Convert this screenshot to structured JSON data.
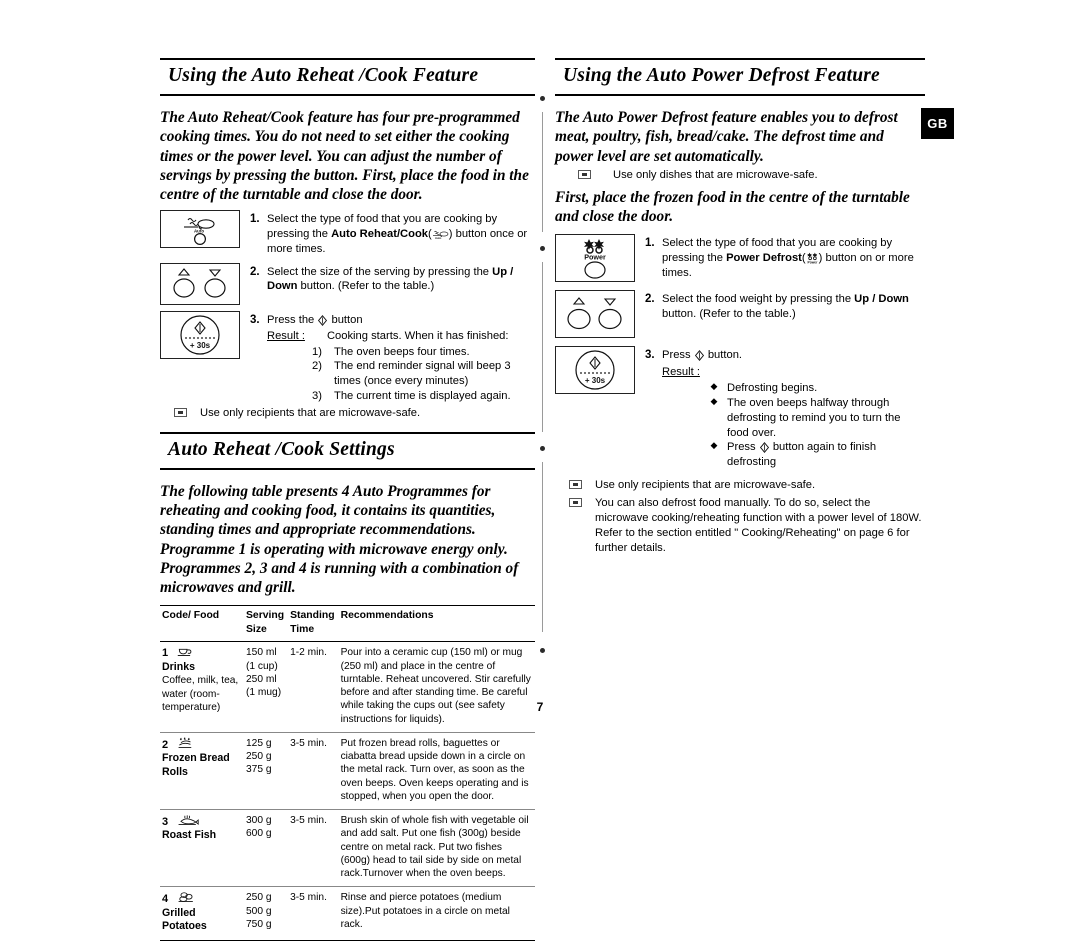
{
  "page": {
    "number": "7",
    "locale_badge": "GB"
  },
  "left": {
    "heading": "Using the Auto Reheat /Cook Feature",
    "intro": "The Auto Reheat/Cook feature has four pre-programmed cooking times. You do not need to set either the cooking times or the power level. You can adjust the number of servings by pressing the button. First, place the food in the centre of the turntable and close the door.",
    "steps": [
      {
        "num": "1.",
        "icon": "auto-reheat-cook-button-icon",
        "text_before": "Select the type of food that you are cooking by pressing the ",
        "bold_label": "Auto Reheat/Cook",
        "text_after": " button once or more times."
      },
      {
        "num": "2.",
        "icon": "up-down-button-icon",
        "text_before": "Select the size of the serving by pressing the ",
        "bold_label": "Up / Down",
        "text_after": " button. (Refer to the table.)"
      },
      {
        "num": "3.",
        "icon": "start-plus30s-button-icon",
        "text_before": "Press the ",
        "bold_label": "",
        "text_after": " button"
      }
    ],
    "result_label": "Result :",
    "result_intro": "Cooking starts. When it has finished:",
    "results": [
      {
        "marker": "1)",
        "text": "The oven beeps four times."
      },
      {
        "marker": "2)",
        "text": "The end reminder signal will beep 3 times (once every minutes)"
      },
      {
        "marker": "3)",
        "text": "The current time is displayed again."
      }
    ],
    "note": "Use only recipients that are microwave-safe.",
    "settings_heading": "Auto Reheat /Cook Settings",
    "settings_intro": "The following table presents 4 Auto Programmes for reheating and cooking food, it contains its quantities, standing times and appropriate recommendations. Programme 1 is operating with microwave energy only. Programmes 2, 3 and 4 is running with a combination of microwaves and grill.",
    "table": {
      "columns": [
        "Code/ Food",
        "Serving Size",
        "Standing Time",
        "Recommendations"
      ],
      "rows": [
        {
          "code": "1",
          "icon": "drinks-cup-icon",
          "name": "Drinks",
          "sub": "Coffee, milk, tea, water (room-temperature)",
          "serving": "150 ml\n(1 cup)\n250 ml\n(1 mug)",
          "standing": "1-2 min.",
          "recommendations": "Pour into a ceramic cup (150 ml) or mug (250 ml) and place in the centre of turntable. Reheat uncovered. Stir carefully before and after standing time. Be careful while taking the cups out (see safety instructions for liquids)."
        },
        {
          "code": "2",
          "icon": "frozen-bread-rolls-icon",
          "name": "Frozen Bread Rolls",
          "sub": "",
          "serving": "125 g\n250 g\n375 g",
          "standing": "3-5 min.",
          "recommendations": "Put frozen bread rolls, baguettes or ciabatta bread upside down in a circle on the metal rack. Turn over, as soon as the oven beeps. Oven keeps operating and is stopped, when you open the door."
        },
        {
          "code": "3",
          "icon": "roast-fish-icon",
          "name": "Roast Fish",
          "sub": "",
          "serving": "300 g\n600 g",
          "standing": "3-5 min.",
          "recommendations": "Brush skin of whole fish with vegetable oil and add salt. Put one fish (300g) beside centre on metal rack. Put two fishes (600g) head to tail side by side on metal rack.Turnover when the oven beeps."
        },
        {
          "code": "4",
          "icon": "grilled-potatoes-icon",
          "name": "Grilled Potatoes",
          "sub": "",
          "serving": "250 g\n500 g\n750 g",
          "standing": "3-5 min.",
          "recommendations": "Rinse and pierce potatoes (medium size).Put potatoes in a circle on metal rack."
        }
      ]
    }
  },
  "right": {
    "heading": "Using the Auto Power Defrost Feature",
    "intro": "The Auto Power Defrost feature enables you to defrost meat, poultry, fish, bread/cake. The defrost time and power level are set automatically.",
    "note_top": "Use only dishes that are microwave-safe.",
    "intro2": "First, place the frozen food in the centre of the turntable and close the door.",
    "steps": [
      {
        "num": "1.",
        "icon": "power-defrost-button-icon",
        "text_before": "Select the type of food that you are cooking by pressing the ",
        "bold_label": "Power Defrost",
        "text_after": " button on or more times."
      },
      {
        "num": "2.",
        "icon": "up-down-button-icon",
        "text_before": "Select the food weight by pressing the ",
        "bold_label": "Up / Down",
        "text_after": " button. (Refer to the table.)"
      },
      {
        "num": "3.",
        "icon": "start-plus30s-button-icon",
        "text_before": "Press ",
        "bold_label": "",
        "text_after": " button."
      }
    ],
    "result_label": "Result :",
    "results": [
      {
        "text": "Defrosting begins."
      },
      {
        "text": "The oven beeps halfway through defrosting to remind you to turn the food over."
      },
      {
        "text_before": "Press ",
        "text_after": " button again to finish defrosting"
      }
    ],
    "notes": [
      "Use only recipients that are microwave-safe.",
      "You can also defrost food manually. To do so, select the microwave cooking/reheating function with a power level of 180W. Refer to the section entitled \" Cooking/Reheating\" on page 6 for further details."
    ]
  },
  "icons": {
    "auto_label": "Auto",
    "power_label": "Power",
    "plus30s_label": "+ 30s"
  }
}
